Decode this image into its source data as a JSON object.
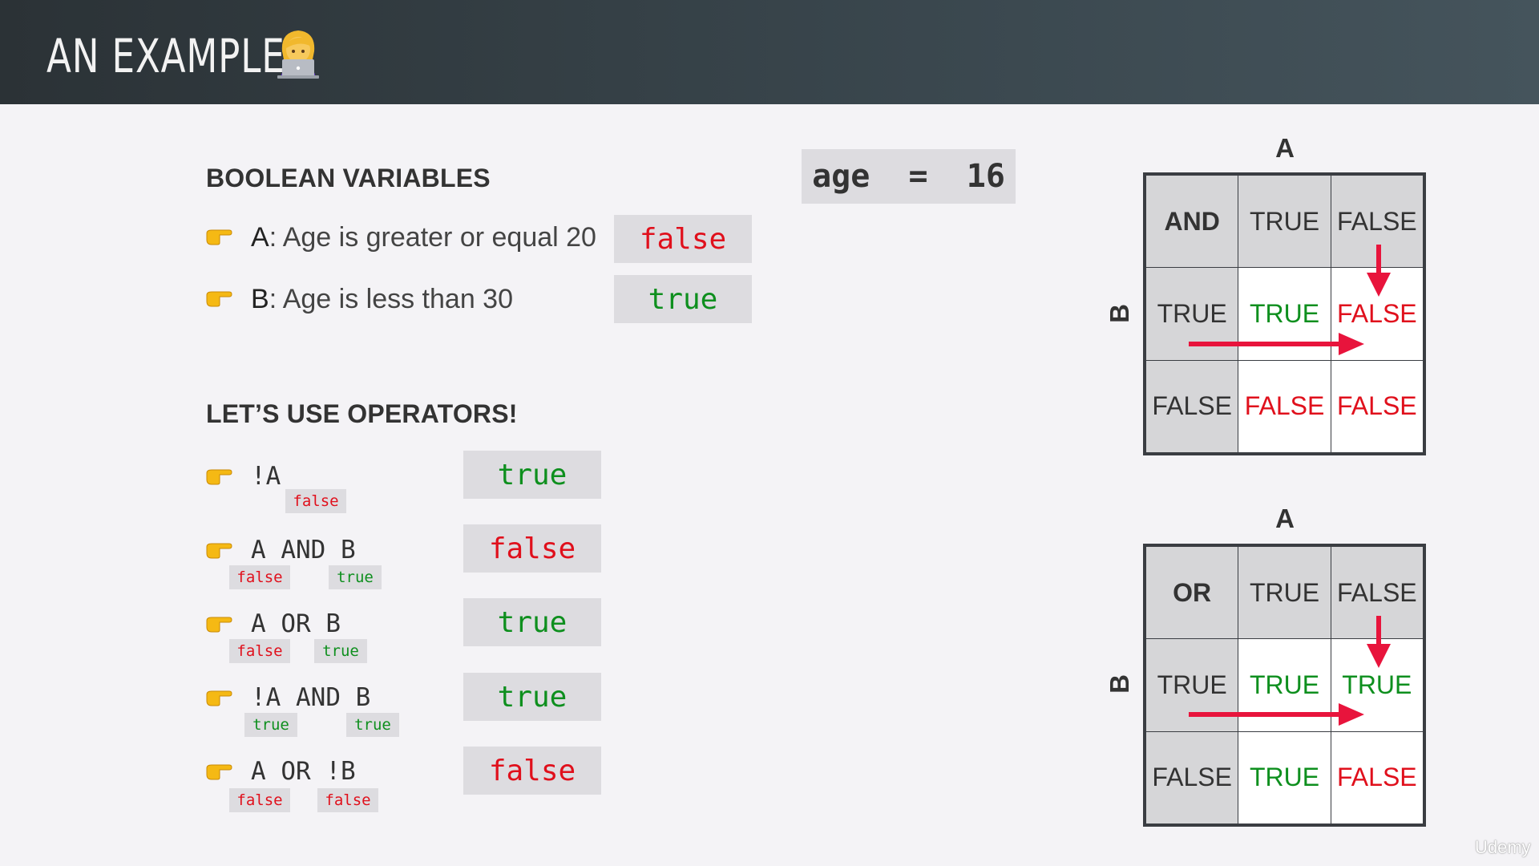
{
  "header": {
    "title": "AN EXAMPLE",
    "emoji_icon": "woman-technologist-icon"
  },
  "boolean_section": {
    "title": "BOOLEAN VARIABLES",
    "variables": [
      {
        "key": "A",
        "text": ": Age is greater or equal 20",
        "value": "false"
      },
      {
        "key": "B",
        "text": ": Age is less than 30",
        "value": "true"
      }
    ]
  },
  "age_box": {
    "text": "age  =  16"
  },
  "operators_section": {
    "title": "LET’S USE OPERATORS!",
    "items": [
      {
        "expr": "!A",
        "result": "false",
        "chips": [
          "false"
        ]
      },
      {
        "expr": "A AND B",
        "result": "false",
        "chips": [
          "false",
          "true"
        ]
      },
      {
        "expr": "A OR B",
        "result": "true",
        "chips": [
          "false",
          "true"
        ]
      },
      {
        "expr": "!A AND B",
        "result": "true",
        "chips": [
          "true",
          "true"
        ]
      },
      {
        "expr": "A OR !B",
        "result": "false",
        "chips": [
          "false",
          "false"
        ]
      }
    ],
    "results": [
      "true",
      "false",
      "true",
      "true",
      "false"
    ]
  },
  "and_table": {
    "label_a": "A",
    "label_b": "B",
    "cells": [
      [
        "AND",
        "TRUE",
        "FALSE"
      ],
      [
        "TRUE",
        "TRUE",
        "FALSE"
      ],
      [
        "FALSE",
        "FALSE",
        "FALSE"
      ]
    ]
  },
  "or_table": {
    "label_a": "A",
    "label_b": "B",
    "cells": [
      [
        "OR",
        "TRUE",
        "FALSE"
      ],
      [
        "TRUE",
        "TRUE",
        "TRUE"
      ],
      [
        "FALSE",
        "TRUE",
        "FALSE"
      ]
    ]
  },
  "colors": {
    "true": "#0e8f1e",
    "false": "#e0101c",
    "arrow": "#e8143c"
  },
  "watermark": "Udemy"
}
